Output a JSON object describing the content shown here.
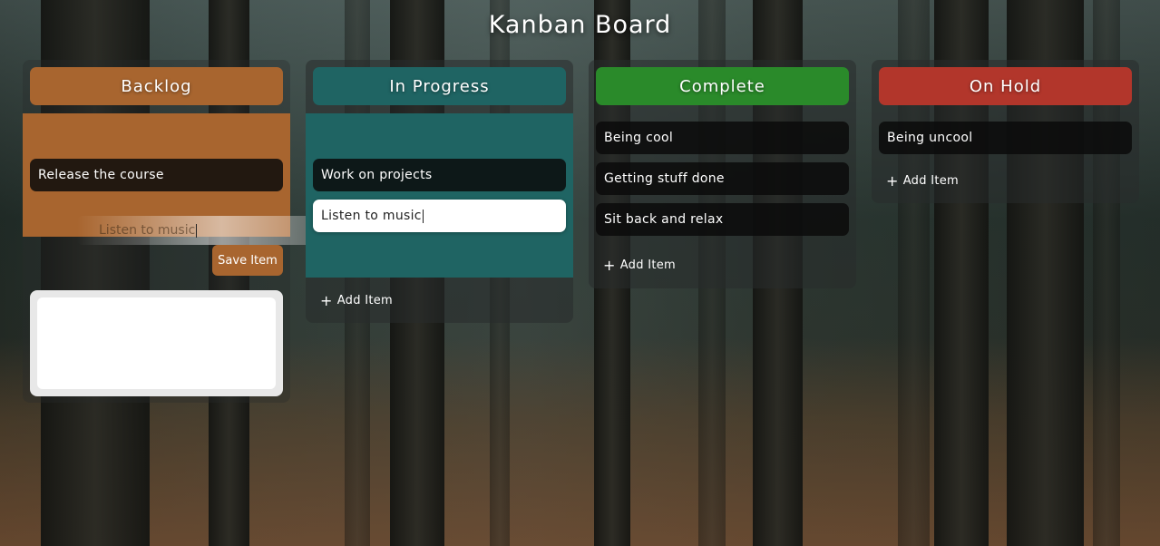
{
  "title": "Kanban Board",
  "colors": {
    "backlog": "#a8652f",
    "in_progress": "#1f6463",
    "complete": "#2a8a2a",
    "on_hold": "#b2362b"
  },
  "columns": {
    "backlog": {
      "header": "Backlog",
      "items": [
        "Release the course"
      ],
      "dragging_text": "Listen to music",
      "save_label": "Save Item"
    },
    "in_progress": {
      "header": "In Progress",
      "items": [
        "Work on projects",
        "Listen to music"
      ],
      "add_label": "Add Item"
    },
    "complete": {
      "header": "Complete",
      "items": [
        "Being cool",
        "Getting stuff done",
        "Sit back and relax"
      ],
      "add_label": "Add Item"
    },
    "on_hold": {
      "header": "On Hold",
      "items": [
        "Being uncool"
      ],
      "add_label": "Add Item"
    }
  },
  "icons": {
    "add": "plus-icon"
  },
  "plus_glyph": "+"
}
